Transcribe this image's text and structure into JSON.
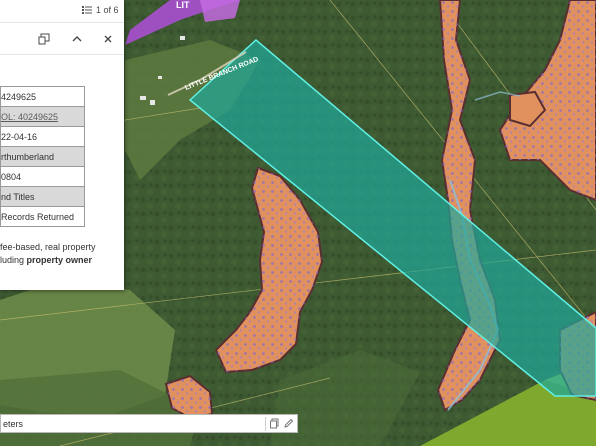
{
  "colors": {
    "forest": "#3e5a32",
    "field": "#6b8a45",
    "parcel_fill": "#1fa89a",
    "parcel_outline": "#5ff0e6",
    "wetland_fill": "#e0915e",
    "wetland_dots": "#8c6cc0",
    "wetland_outline": "#5a2e30",
    "purple_zone": "#a84fd0",
    "green_zone": "#7fa92e",
    "popup_bg": "#ffffff",
    "row_shade": "#d9d9d9"
  },
  "map": {
    "road_label": "LITTLE BRANCH ROAD",
    "corner_label": "LIT"
  },
  "popup": {
    "pager_text": "1 of 6",
    "pager_icon": "list-icon",
    "dock_icon": "dock-icon",
    "collapse_icon": "chevron-up-icon",
    "close_icon": "close-icon",
    "rows": [
      "4249625",
      "OL: 40249625",
      "22-04-16",
      "rthumberland",
      "0804",
      "nd Titles",
      " Records Returned"
    ],
    "desc_line1": "fee-based, real property",
    "desc_line2_prefix": "luding ",
    "desc_line2_bold": "property owner"
  },
  "scalebar": {
    "label": "eters",
    "copy_icon": "copy-icon",
    "edit_icon": "edit-icon"
  }
}
